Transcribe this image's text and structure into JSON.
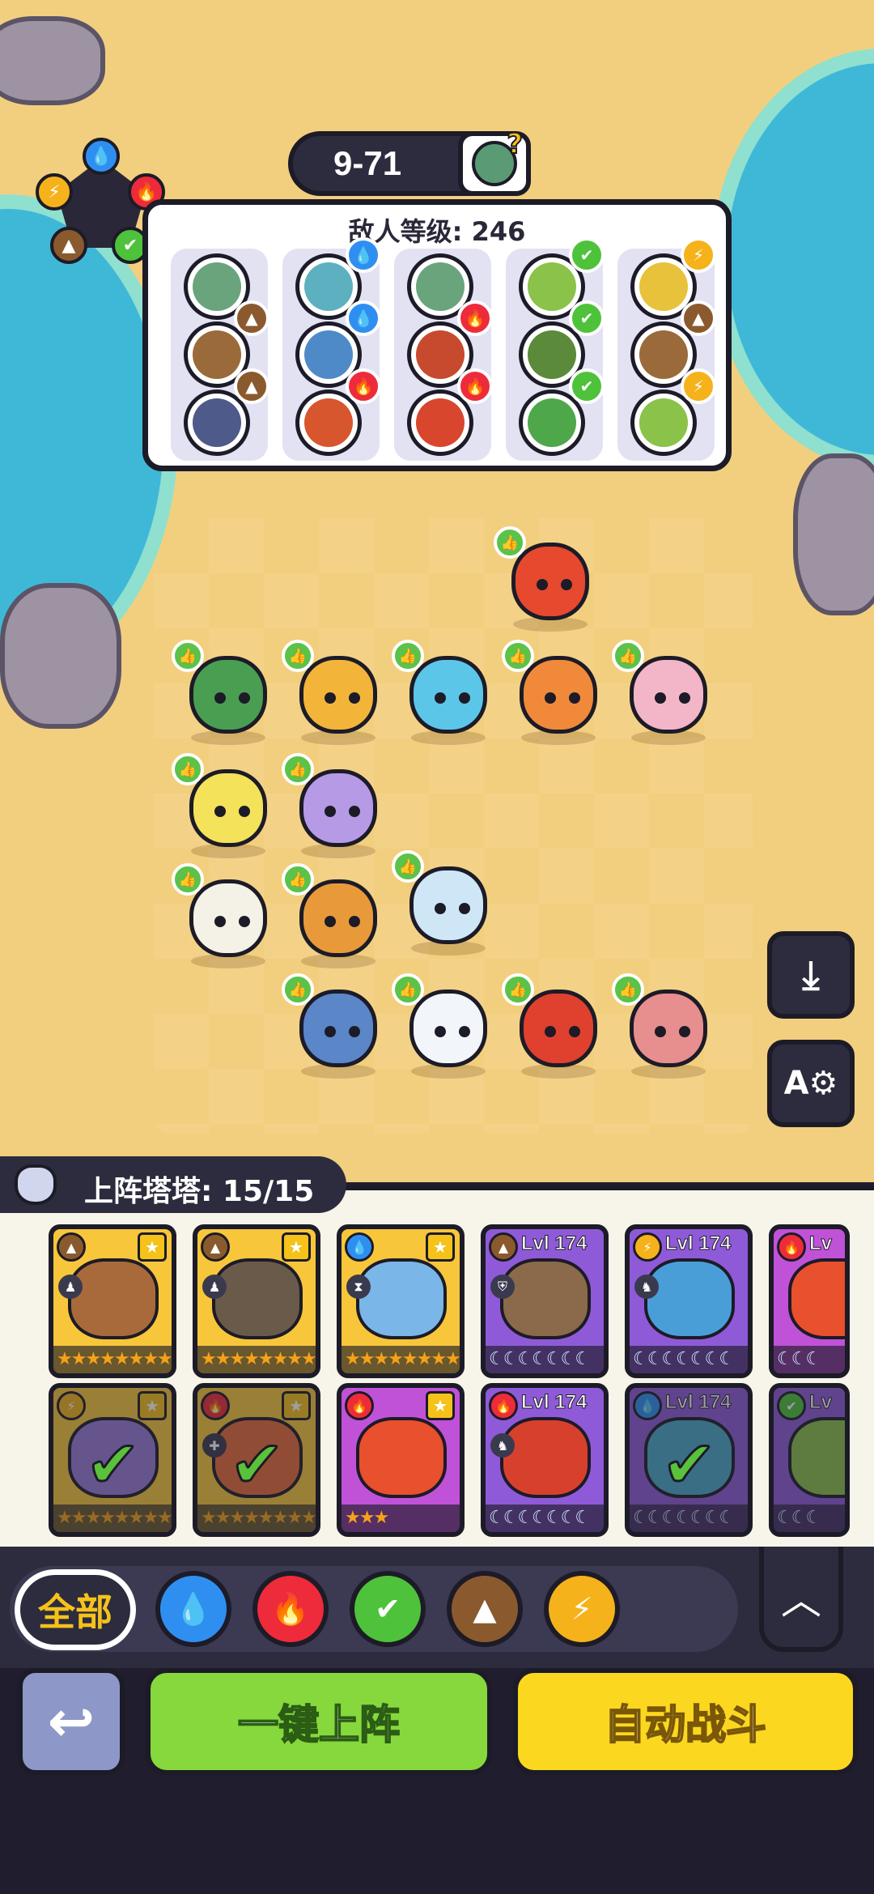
{
  "stage": {
    "label": "9-71"
  },
  "enemy_panel": {
    "level_label": "敌人等级: 246"
  },
  "team": {
    "deployed_label": "上阵塔塔: 15/15"
  },
  "elements": {
    "water": "#2f8ff0",
    "fire": "#ee2b3a",
    "grass": "#4ec23a",
    "earth": "#8a5a2e",
    "thunder": "#f5b21a"
  },
  "roster_cards": [
    {
      "level": "",
      "element": "earth",
      "favorite": true,
      "stars": "★★★★★★★★★"
    },
    {
      "level": "",
      "element": "earth",
      "favorite": true,
      "stars": "★★★★★★★★★"
    },
    {
      "level": "",
      "element": "water",
      "favorite": true,
      "stars": "★★★★★★★★★"
    },
    {
      "level": "Lvl 174",
      "element": "earth",
      "favorite": false,
      "stars": "☾☾☾☾☾☾☾"
    },
    {
      "level": "Lvl 174",
      "element": "thunder",
      "favorite": false,
      "stars": "☾☾☾☾☾☾☾"
    },
    {
      "level": "Lv",
      "element": "fire",
      "favorite": false,
      "stars": "☾☾☾"
    },
    {
      "level": "",
      "element": "thunder",
      "favorite": true,
      "stars": "★★★★★★★★★"
    },
    {
      "level": "",
      "element": "fire",
      "favorite": true,
      "stars": "★★★★★★★★★"
    },
    {
      "level": "",
      "element": "fire",
      "favorite": true,
      "stars": "★★★"
    },
    {
      "level": "Lvl 174",
      "element": "fire",
      "favorite": false,
      "stars": "☾☾☾☾☾☾☾"
    },
    {
      "level": "Lvl 174",
      "element": "water",
      "favorite": false,
      "stars": "☾☾☾☾☾☾☾"
    },
    {
      "level": "Lv",
      "element": "grass",
      "favorite": false,
      "stars": "☾☾☾"
    }
  ],
  "filters": {
    "all_label": "全部"
  },
  "actions": {
    "deploy_label": "一键上阵",
    "auto_battle_label": "自动战斗"
  }
}
